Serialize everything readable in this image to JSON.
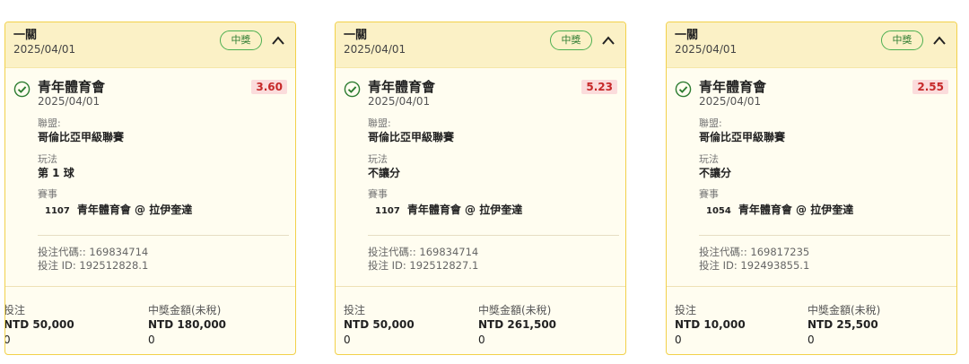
{
  "cards": [
    {
      "header_title": "一關",
      "header_date": "2025/04/01",
      "badge": "中獎",
      "team": "青年體育會",
      "team_date": "2025/04/01",
      "odds": "3.60",
      "league_label": "聯盟:",
      "league": "哥倫比亞甲級聯賽",
      "play_label": "玩法",
      "play": "第 1 球",
      "event_label": "賽事",
      "event_no": "1107",
      "event": "青年體育會 @ 拉伊奎達",
      "bet_code": "投注代碼:: 169834714",
      "bet_id": "投注 ID: 192512828.1",
      "stake_label": "投注",
      "win_label": "中獎金額(未稅)",
      "stake": "NTD 50,000",
      "win": "NTD 180,000",
      "stake_sub": "0",
      "win_sub": "0"
    },
    {
      "header_title": "一關",
      "header_date": "2025/04/01",
      "badge": "中獎",
      "team": "青年體育會",
      "team_date": "2025/04/01",
      "odds": "5.23",
      "league_label": "聯盟:",
      "league": "哥倫比亞甲級聯賽",
      "play_label": "玩法",
      "play": "不讓分",
      "event_label": "賽事",
      "event_no": "1107",
      "event": "青年體育會 @ 拉伊奎達",
      "bet_code": "投注代碼:: 169834714",
      "bet_id": "投注 ID: 192512827.1",
      "stake_label": "投注",
      "win_label": "中獎金額(未稅)",
      "stake": "NTD 50,000",
      "win": "NTD 261,500",
      "stake_sub": "0",
      "win_sub": "0"
    },
    {
      "header_title": "一關",
      "header_date": "2025/04/01",
      "badge": "中獎",
      "team": "青年體育會",
      "team_date": "2025/04/01",
      "odds": "2.55",
      "league_label": "聯盟:",
      "league": "哥倫比亞甲級聯賽",
      "play_label": "玩法",
      "play": "不讓分",
      "event_label": "賽事",
      "event_no": "1054",
      "event": "青年體育會 @ 拉伊奎達",
      "bet_code": "投注代碼:: 169817235",
      "bet_id": "投注 ID: 192493855.1",
      "stake_label": "投注",
      "win_label": "中獎金額(未稅)",
      "stake": "NTD 10,000",
      "win": "NTD 25,500",
      "stake_sub": "0",
      "win_sub": "0"
    }
  ],
  "colors": {
    "accent_border": "#f2d14a",
    "header_bg": "#fbf1c6",
    "win_green": "#4caf50",
    "odds_red": "#c62828"
  },
  "icons": {
    "collapse": "chevron-up-icon",
    "status": "check-circle-icon"
  }
}
